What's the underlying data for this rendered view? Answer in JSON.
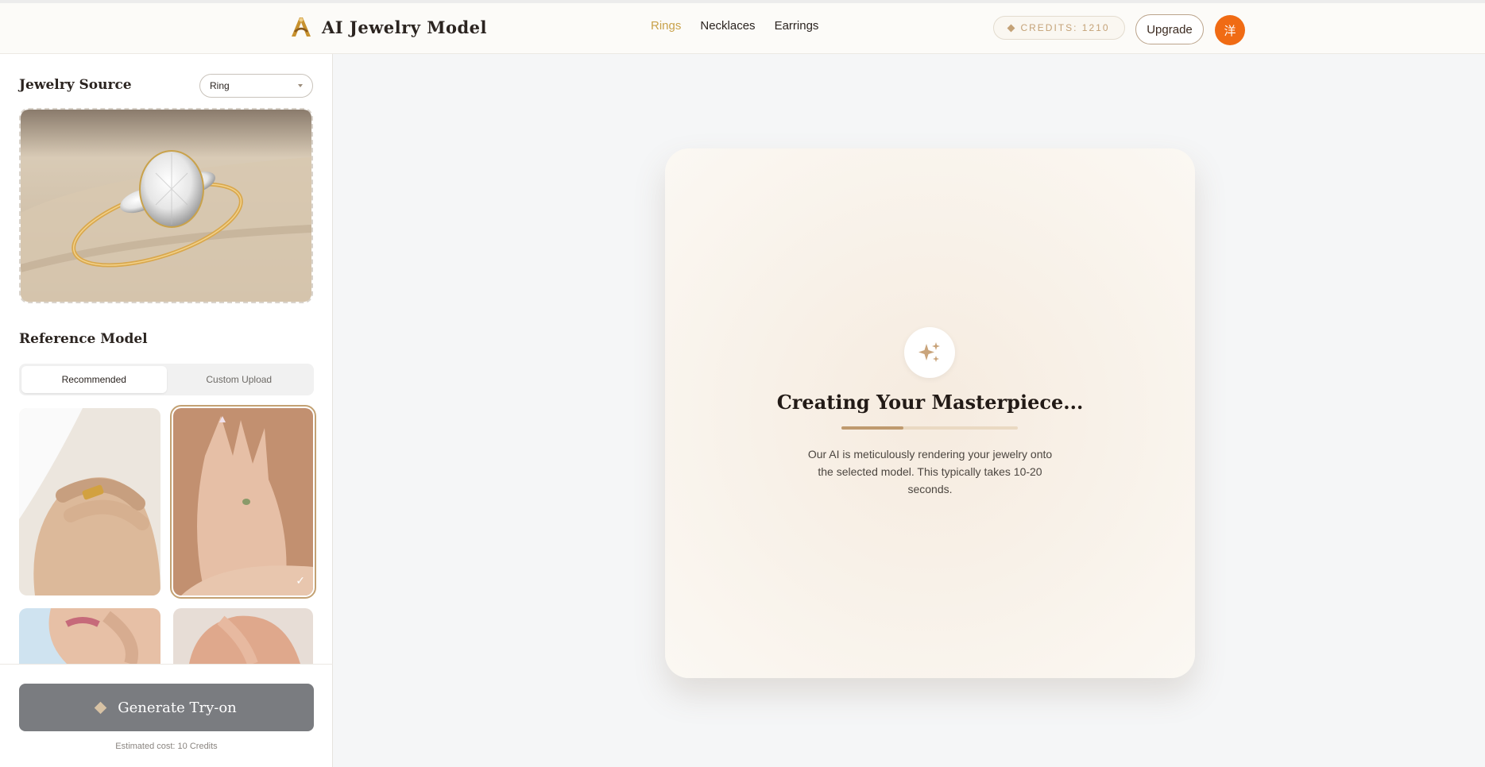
{
  "header": {
    "brand_name": "AI Jewelry Model",
    "nav": [
      {
        "label": "Rings",
        "active": true
      },
      {
        "label": "Necklaces",
        "active": false
      },
      {
        "label": "Earrings",
        "active": false
      }
    ],
    "credits_label": "CREDITS: 1210",
    "upgrade_label": "Upgrade",
    "avatar_text": "洋"
  },
  "sidebar": {
    "jewelry_source_title": "Jewelry Source",
    "source_type_selected": "Ring",
    "reference_model_title": "Reference Model",
    "tabs": [
      {
        "label": "Recommended",
        "active": true
      },
      {
        "label": "Custom Upload",
        "active": false
      }
    ],
    "selected_model_index": 1,
    "check_mark": "✓",
    "generate_label": "Generate Try-on",
    "estimated_cost": "Estimated cost: 10 Credits"
  },
  "main": {
    "title": "Creating Your Masterpiece...",
    "progress": 0.35,
    "description": "Our AI is meticulously rendering your jewelry onto the selected model. This typically takes 10-20 seconds."
  },
  "colors": {
    "accent_gold": "#c9a24b",
    "avatar_orange": "#f06b14",
    "progress_fill": "#bf9a6e",
    "button_gray": "#7a7c80"
  }
}
